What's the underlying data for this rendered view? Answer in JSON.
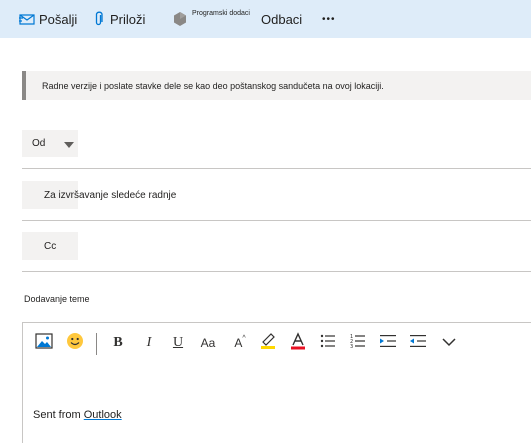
{
  "toolbar": {
    "send_label": "Pošalji",
    "attach_label": "Priloži",
    "addins_label": "Programski dodaci",
    "discard_label": "Odbaci",
    "more_label": "•••"
  },
  "info_bar": {
    "text": "Radne verzije i poslate stavke dele se kao deo poštanskog sandučeta na ovoj lokaciji."
  },
  "fields": {
    "from_label": "Od",
    "to_label": "Za izvršavanje sledeće radnje",
    "cc_label": "Cc",
    "subject_placeholder": "Dodavanje teme"
  },
  "formatting": {
    "bold": "B",
    "italic": "I",
    "underline": "U",
    "font_size": "Aa",
    "grow_font": "A"
  },
  "body": {
    "text_prefix": "Sent from ",
    "text_link": "Outlook"
  },
  "colors": {
    "toolbar_bg": "#deecf9",
    "accent": "#0078d4",
    "highlight": "#ffd800",
    "font_color": "#e81123"
  }
}
